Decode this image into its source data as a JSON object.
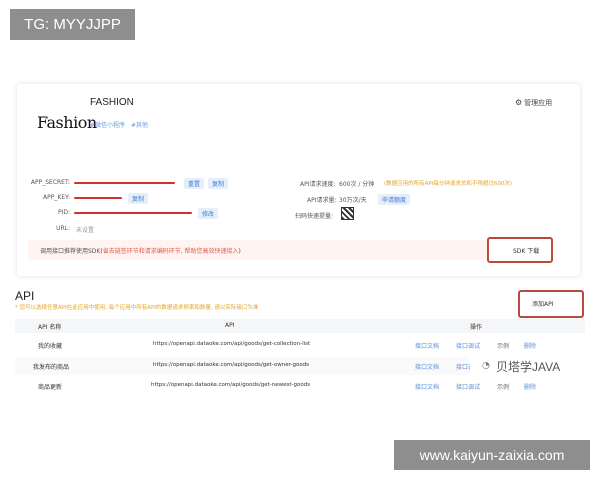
{
  "overlays": {
    "top_tag": "TG: MYYJJPP",
    "bottom_url": "www.kaiyun-zaixia.com",
    "watermark": "贝塔学JAVA"
  },
  "app": {
    "logo": "Fashion",
    "name": "FASHION",
    "tags": [
      "#微信小程序",
      "#其他"
    ],
    "manage": "管理应用"
  },
  "credentials": {
    "secret_label": "APP_SECRET:",
    "key_label": "APP_KEY:",
    "pid_label": "PID:",
    "url_label": "URL:",
    "url_value": "未设置",
    "reset": "重置",
    "copy": "复制",
    "copy2": "复制",
    "modify": "修改"
  },
  "limits": {
    "speed_label": "API请求速度:",
    "speed_value": "600次 / 分钟",
    "speed_note": "(数据应用的所有API每分钟请求总和不得超过600次)",
    "volume_label": "API请求量:",
    "volume_value": "30万次/天",
    "apply": "申请额度",
    "qr_label": "扫码快速提量:"
  },
  "notice": {
    "text": "调用接口推荐使用SDK(",
    "hint": "省去链签环节和请求编码环节, 帮助您高效快速接入",
    "end": ")",
    "sdk_button": "SDK 下载"
  },
  "api": {
    "title": "API",
    "hint": "* 您可以选择任意API在此应用中使用, 每个应用中所有API的数据请求频率和数量, 请以实际接口为准",
    "add_button": "添加API",
    "columns": [
      "API 名称",
      "API",
      "操作"
    ],
    "rows": [
      {
        "name": "我的收藏",
        "url": "https://openapi.dataoke.com/api/goods/get-collection-list",
        "doc": "接口文档",
        "test": "接口调试",
        "example": "示例",
        "del": "删除"
      },
      {
        "name": "我发布的商品",
        "url": "https://openapi.dataoke.com/api/goods/get-owner-goods",
        "doc": "接口文档",
        "test": "接口调试",
        "example": "示例",
        "del": "删除"
      },
      {
        "name": "商品更新",
        "url": "https://openapi.dataoke.com/api/goods/get-newest-goods",
        "doc": "接口文档",
        "test": "接口调试",
        "example": "示例",
        "del": "删除"
      }
    ]
  }
}
